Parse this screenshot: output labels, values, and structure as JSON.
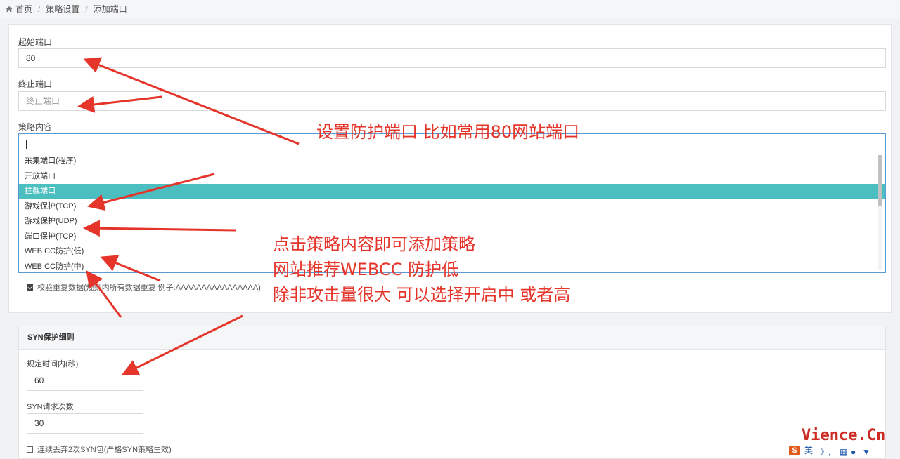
{
  "breadcrumb": {
    "home": "首页",
    "section": "策略设置",
    "current": "添加端口"
  },
  "form": {
    "start_port_label": "起始端口",
    "start_port_value": "80",
    "end_port_label": "终止端口",
    "end_port_placeholder": "终止端口",
    "policy_label": "策略内容",
    "policy_options": [
      "采集端口(程序)",
      "开放端口",
      "拦截端口",
      "游戏保护(TCP)",
      "游戏保护(UDP)",
      "端口保护(TCP)",
      "WEB CC防护(低)",
      "WEB CC防护(中)"
    ],
    "policy_active_index": 2,
    "verify_checkbox_label": "校验重复数据(规则内所有数据重复 例子:AAAAAAAAAAAAAAAA)",
    "verify_checked": true
  },
  "syn": {
    "title": "SYN保护细则",
    "time_label": "规定时间内(秒)",
    "time_value": "60",
    "count_label": "SYN请求次数",
    "count_value": "30",
    "drop_label": "连续丢弃2次SYN包(严格SYN策略生效)",
    "drop_checked": false
  },
  "annotations": {
    "port_note": "设置防护端口 比如常用80网站端口",
    "policy_note_1": "点击策略内容即可添加策略",
    "policy_note_2": "网站推荐WEBCC 防护低",
    "policy_note_3": "除非攻击量很大 可以选择开启中 或者高"
  },
  "watermark": "Vience.Cn",
  "ime": {
    "mode": "英"
  },
  "colors": {
    "accent": "#4bbfc0",
    "focus": "#5b9bd5",
    "annotation": "#e5352b"
  }
}
